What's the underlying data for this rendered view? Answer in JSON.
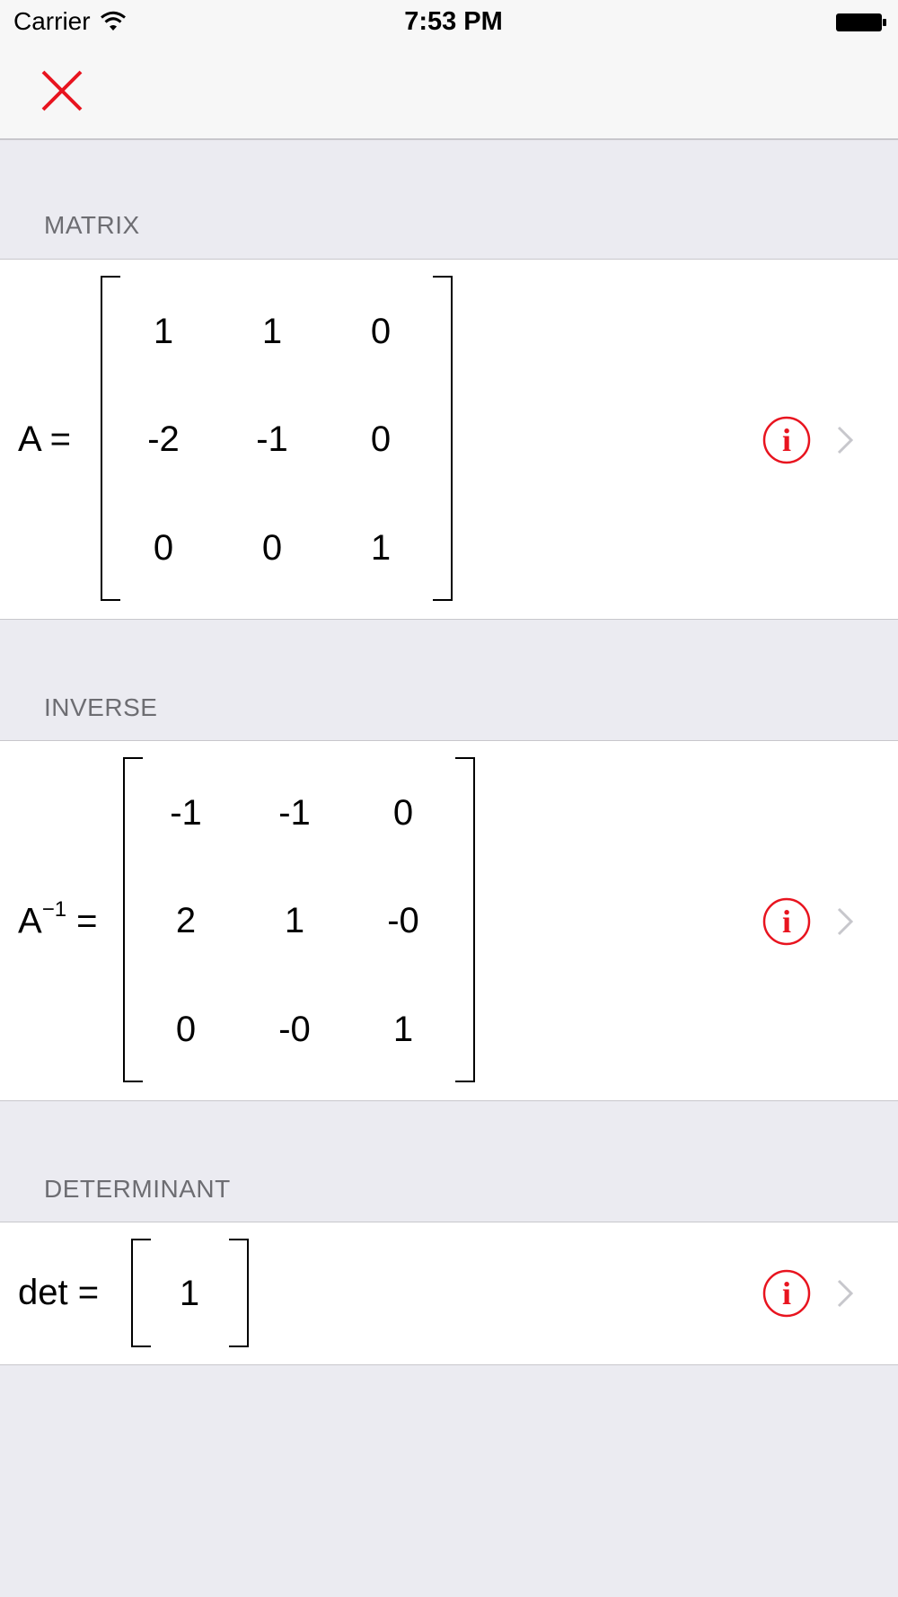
{
  "status_bar": {
    "carrier": "Carrier",
    "time": "7:53 PM"
  },
  "nav": {
    "close_icon": "close-x-icon",
    "accent_color": "#e8141f"
  },
  "sections": {
    "matrix": {
      "header": "MATRIX",
      "label": "A =",
      "rows": [
        [
          "1",
          "1",
          "0"
        ],
        [
          "-2",
          "-1",
          "0"
        ],
        [
          "0",
          "0",
          "1"
        ]
      ]
    },
    "inverse": {
      "header": "INVERSE",
      "label_base": "A",
      "label_sup": "−1",
      "label_eq": " =",
      "rows": [
        [
          "-1",
          "-1",
          "0"
        ],
        [
          "2",
          "1",
          "-0"
        ],
        [
          "0",
          "-0",
          "1"
        ]
      ]
    },
    "determinant": {
      "header": "DETERMINANT",
      "label": "det =",
      "value": "1"
    }
  },
  "icons": {
    "info": "info-circle-icon",
    "disclosure": "chevron-right-icon"
  }
}
